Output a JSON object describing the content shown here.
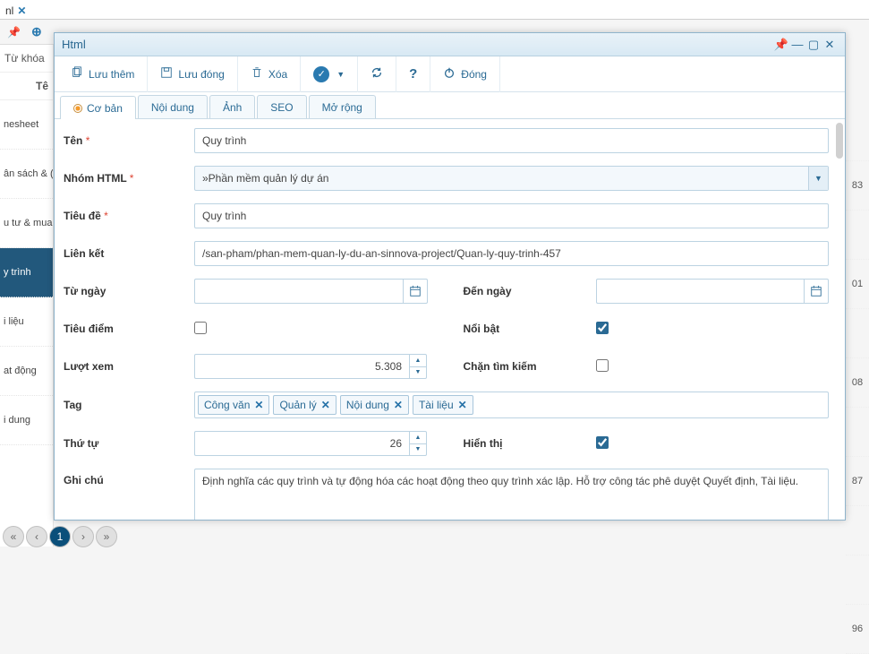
{
  "bg": {
    "tab_label": "nl",
    "search_label": "Từ khóa",
    "header_col": "Tê",
    "rows": [
      "nesheet",
      "ân sách & (",
      "u tư & mua",
      "y trình",
      "i liệu",
      "at động",
      "i dung"
    ],
    "selected_index": 3,
    "right_numbers": [
      "",
      "83",
      "",
      "01",
      "",
      "08",
      "",
      "87",
      "",
      "",
      "96"
    ],
    "pager_current": "1"
  },
  "window": {
    "title": "Html"
  },
  "toolbar": {
    "save_more": "Lưu thêm",
    "save_close": "Lưu đóng",
    "delete": "Xóa",
    "close": "Đóng"
  },
  "tabs": [
    "Cơ bản",
    "Nội dung",
    "Ảnh",
    "SEO",
    "Mở rộng"
  ],
  "active_tab": 0,
  "form": {
    "ten_label": "Tên",
    "ten_value": "Quy trình",
    "nhom_label": "Nhóm HTML",
    "nhom_value": "»Phần mềm quản lý dự án",
    "tieude_label": "Tiêu đề",
    "tieude_value": "Quy trình",
    "lienket_label": "Liên kết",
    "lienket_value": "/san-pham/phan-mem-quan-ly-du-an-sinnova-project/Quan-ly-quy-trinh-457",
    "tungay_label": "Từ ngày",
    "denngay_label": "Đến ngày",
    "tieudiem_label": "Tiêu điểm",
    "noibat_label": "Nổi bật",
    "luotxem_label": "Lượt xem",
    "luotxem_value": "5.308",
    "chantimkiem_label": "Chặn tìm kiếm",
    "tag_label": "Tag",
    "tags": [
      "Công văn",
      "Quản lý",
      "Nội dung",
      "Tài liệu"
    ],
    "thutu_label": "Thứ tự",
    "thutu_value": "26",
    "hienthi_label": "Hiển thị",
    "ghichu_label": "Ghi chú",
    "ghichu_value": "Định nghĩa các quy trình và tự động hóa các hoạt động theo quy trình xác lập. Hỗ trợ công tác phê duyệt Quyết định, Tài liệu."
  }
}
